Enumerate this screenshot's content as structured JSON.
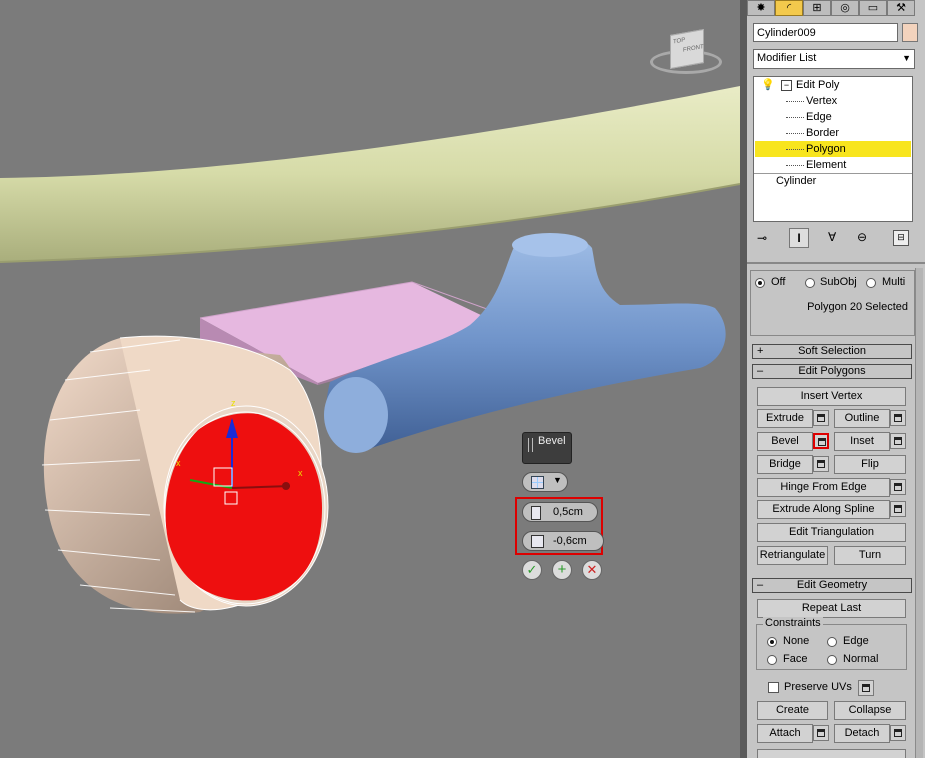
{
  "viewport": {
    "viewcube": {
      "top_label": "TOP",
      "front_label": "FRONT"
    },
    "caddy": {
      "title": "Bevel",
      "height_value": "0,5cm",
      "outline_value": "-0,6cm"
    }
  },
  "panel": {
    "tabs": [
      "create-icon",
      "modify-icon",
      "hierarchy-icon",
      "motion-icon",
      "display-icon",
      "utilities-icon"
    ],
    "object_name": "Cylinder009",
    "object_color": "#f3d3bd",
    "modifier_list": "Modifier List",
    "stack": {
      "edit_poly": "Edit Poly",
      "sub_items": [
        "Vertex",
        "Edge",
        "Border",
        "Polygon",
        "Element"
      ],
      "selected": "Polygon",
      "base": "Cylinder"
    },
    "preview": {
      "off": "Off",
      "subobj": "SubObj",
      "multi": "Multi"
    },
    "selection_status": "Polygon 20 Selected",
    "rollouts": {
      "soft_selection": "Soft Selection",
      "edit_polygons": "Edit Polygons",
      "edit_geometry": "Edit Geometry"
    },
    "buttons": {
      "insert_vertex": "Insert Vertex",
      "extrude": "Extrude",
      "outline": "Outline",
      "bevel": "Bevel",
      "inset": "Inset",
      "bridge": "Bridge",
      "flip": "Flip",
      "hinge_from_edge": "Hinge From Edge",
      "extrude_along_spline": "Extrude Along Spline",
      "edit_triangulation": "Edit Triangulation",
      "retriangulate": "Retriangulate",
      "turn": "Turn",
      "repeat_last": "Repeat Last",
      "create": "Create",
      "collapse": "Collapse",
      "attach": "Attach",
      "detach": "Detach"
    },
    "constraints": {
      "title": "Constraints",
      "none": "None",
      "edge": "Edge",
      "face": "Face",
      "normal": "Normal"
    },
    "preserve_uvs": "Preserve UVs",
    "sign_plus": "+",
    "sign_minus": "–"
  }
}
